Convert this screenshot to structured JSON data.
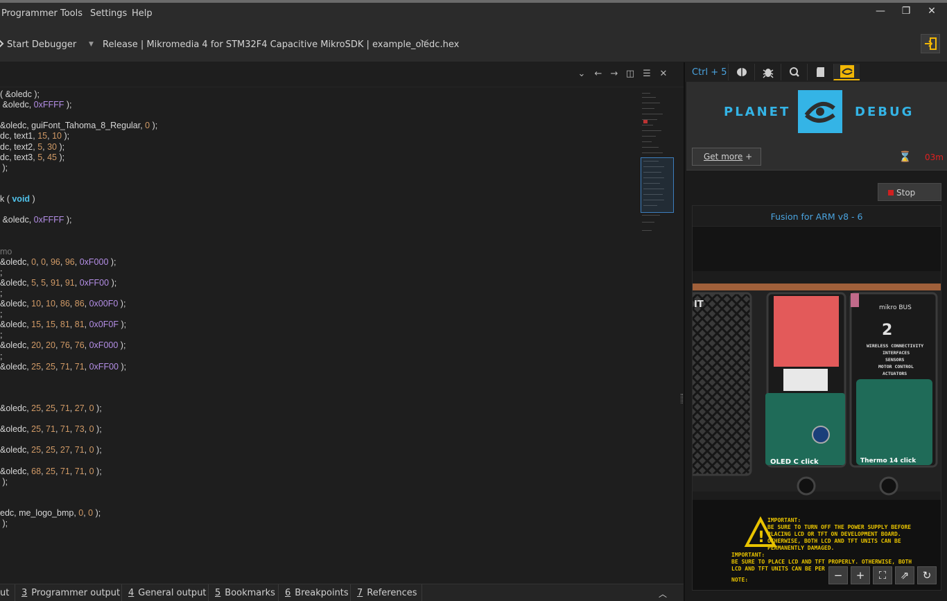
{
  "menu": {
    "items": [
      {
        "label": "Programmer",
        "mnemonic": "P"
      },
      {
        "label": "Tools",
        "mnemonic": "T"
      },
      {
        "label": "Settings",
        "mnemonic": "S"
      },
      {
        "label": "Help",
        "mnemonic": "H"
      }
    ]
  },
  "window": {
    "minimize": "—",
    "restore": "❐",
    "close": "✕"
  },
  "toolbar": {
    "start_debugger": "Start Debugger",
    "config": "Release | Mikromedia 4 for STM32F4 Capacitive MikroSDK | example_oledc.hex"
  },
  "code_lines": [
    "( &oledc );",
    " &oledc, 0xFFFF );",
    "",
    "&oledc, guiFont_Tahoma_8_Regular, 0 );",
    "dc, text1, 15, 10 );",
    "dc, text2, 5, 30 );",
    "dc, text3, 5, 45 );",
    " );",
    "",
    "",
    "k ( void )",
    "",
    " &oledc, 0xFFFF );",
    "",
    "",
    "mo",
    "&oledc, 0, 0, 96, 96, 0xF000 );",
    ";",
    "&oledc, 5, 5, 91, 91, 0xFF00 );",
    ";",
    "&oledc, 10, 10, 86, 86, 0x00F0 );",
    ";",
    "&oledc, 15, 15, 81, 81, 0x0F0F );",
    ";",
    "&oledc, 20, 20, 76, 76, 0xF000 );",
    ";",
    "&oledc, 25, 25, 71, 71, 0xFF00 );",
    "",
    "",
    "",
    "&oledc, 25, 25, 71, 27, 0 );",
    "",
    "&oledc, 25, 71, 71, 73, 0 );",
    "",
    "&oledc, 25, 25, 27, 71, 0 );",
    "",
    "&oledc, 68, 25, 71, 71, 0 );",
    " );",
    "",
    "",
    "edc, me_logo_bmp, 0, 0 );",
    " );"
  ],
  "bottom_tabs": [
    {
      "num": "",
      "label": "ut"
    },
    {
      "num": "3",
      "label": "Programmer output"
    },
    {
      "num": "4",
      "label": "General output"
    },
    {
      "num": "5",
      "label": "Bookmarks"
    },
    {
      "num": "6",
      "label": "Breakpoints"
    },
    {
      "num": "7",
      "label": "References"
    }
  ],
  "panel": {
    "shortcut": "Ctrl + 5",
    "tabs": [
      "brain-icon",
      "bug-icon",
      "zoom-icon",
      "sdcard-icon",
      "planet-debug-icon"
    ],
    "planet_word_left": "PLANET",
    "planet_word_right": "DEBUG",
    "get_more": "Get more",
    "timer": "03m",
    "stop": "Stop",
    "fusion_title": "Fusion for ARM v8 - 6",
    "board": {
      "mikrobus": "mikro BUS",
      "slot_number": "2",
      "feature_list": [
        "WIRELESS CONNECTIVITY",
        "INTERFACES",
        "SENSORS",
        "MOTOR CONTROL",
        "ACTUATORS"
      ],
      "click_left": "OLED C click",
      "click_right": "Thermo 14 click",
      "important_1": "IMPORTANT:\nBE SURE TO TURN OFF THE POWER SUPPLY BEFORE\nPLACING LCD OR TFT ON DEVELOPMENT BOARD.\nOTHERWISE, BOTH LCD AND TFT UNITS CAN BE\nPERMANENTLY DAMAGED.",
      "important_2": "IMPORTANT:\nBE SURE TO PLACE LCD AND TFT PROPERLY. OTHERWISE, BOTH\nLCD AND TFT UNITS CAN BE PER",
      "note": "NOTE:"
    }
  },
  "colors": {
    "accent": "#34b4e6",
    "link": "#4aa3df",
    "tab_active": "#f2b705",
    "stop_red": "#d02020"
  }
}
